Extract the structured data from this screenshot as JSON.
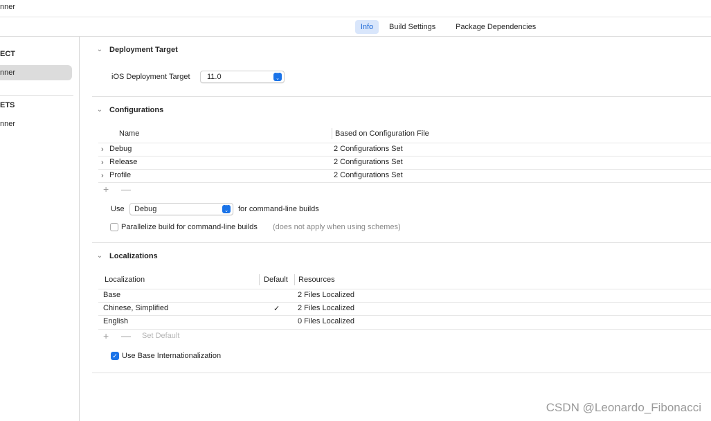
{
  "window": {
    "title": "nner"
  },
  "tabs": [
    {
      "label": "Info",
      "selected": true
    },
    {
      "label": "Build Settings",
      "selected": false
    },
    {
      "label": "Package Dependencies",
      "selected": false
    }
  ],
  "sidebar": {
    "project_header": "ECT",
    "project_item": "nner",
    "targets_header": "ETS",
    "target_item": "nner"
  },
  "deployment": {
    "title": "Deployment Target",
    "label": "iOS Deployment Target",
    "value": "11.0"
  },
  "configurations": {
    "title": "Configurations",
    "columns": [
      "Name",
      "Based on Configuration File"
    ],
    "rows": [
      {
        "name": "Debug",
        "file": "2 Configurations Set"
      },
      {
        "name": "Release",
        "file": "2 Configurations Set"
      },
      {
        "name": "Profile",
        "file": "2 Configurations Set"
      }
    ],
    "use_label": "Use",
    "use_value": "Debug",
    "use_suffix": "for command-line builds",
    "parallelize_label": "Parallelize build for command-line builds",
    "parallelize_note": "(does not apply when using schemes)",
    "parallelize_checked": false
  },
  "localizations": {
    "title": "Localizations",
    "columns": [
      "Localization",
      "Default",
      "Resources"
    ],
    "rows": [
      {
        "name": "Base",
        "default": "",
        "resources": "2 Files Localized"
      },
      {
        "name": "Chinese, Simplified",
        "default": "✓",
        "resources": "2 Files Localized"
      },
      {
        "name": "English",
        "default": "",
        "resources": "0 Files Localized"
      }
    ],
    "set_default_label": "Set Default",
    "base_intl_label": "Use Base Internationalization",
    "base_intl_checked": true
  },
  "toolbar_symbols": {
    "add": "+",
    "remove": "—"
  },
  "watermark": "CSDN @Leonardo_Fibonacci",
  "colors": {
    "accent": "#1a73e8",
    "selected_tab_bg": "#d9e6fb",
    "selected_tab_text": "#1a66d6"
  }
}
